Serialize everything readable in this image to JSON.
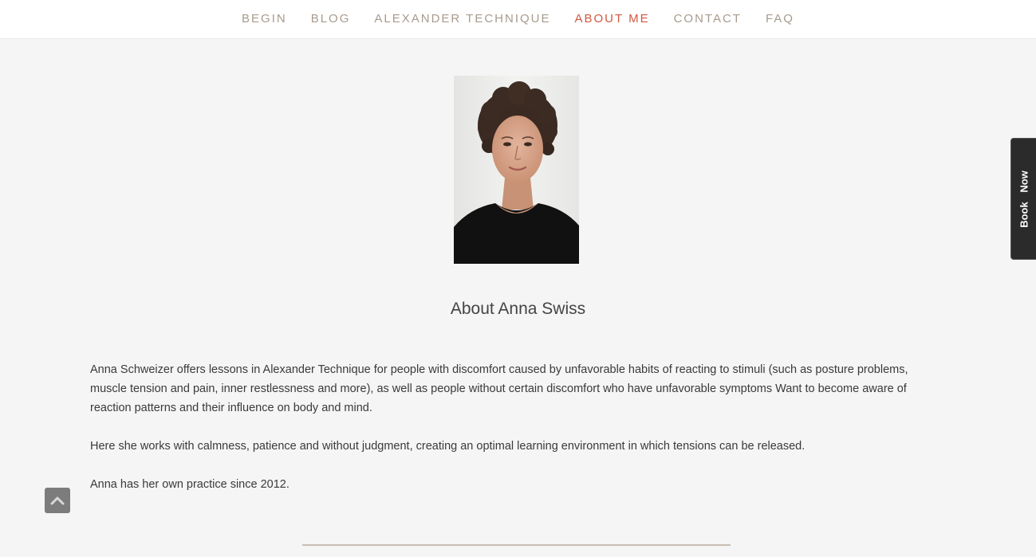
{
  "nav": {
    "items": [
      {
        "label": "BEGIN",
        "active": false
      },
      {
        "label": "BLOG",
        "active": false
      },
      {
        "label": "ALEXANDER TECHNIQUE",
        "active": false
      },
      {
        "label": "ABOUT ME",
        "active": true
      },
      {
        "label": "CONTACT",
        "active": false
      },
      {
        "label": "FAQ",
        "active": false
      }
    ]
  },
  "main": {
    "title": "About Anna Swiss",
    "paragraphs": [
      "Anna Schweizer offers lessons in Alexander Technique for people with discomfort caused by unfavorable habits of reacting to stimuli (such as posture problems, muscle tension and pain, inner restlessness and more), as well as people without certain discomfort who have unfavorable symptoms Want to become aware of reaction patterns and their influence on body and mind.",
      "Here she works with calmness, patience and without judgment, creating an optimal learning environment in which tensions can be released.",
      "Anna has her own practice since 2012."
    ]
  },
  "book_now": {
    "label": "Book Now"
  },
  "scroll_top": {
    "icon": "chevron-up-icon"
  },
  "colors": {
    "nav_text": "#a89b8e",
    "nav_active": "#d2573f",
    "background": "#f5f5f5",
    "book_now_bg": "#2b2b2b"
  }
}
